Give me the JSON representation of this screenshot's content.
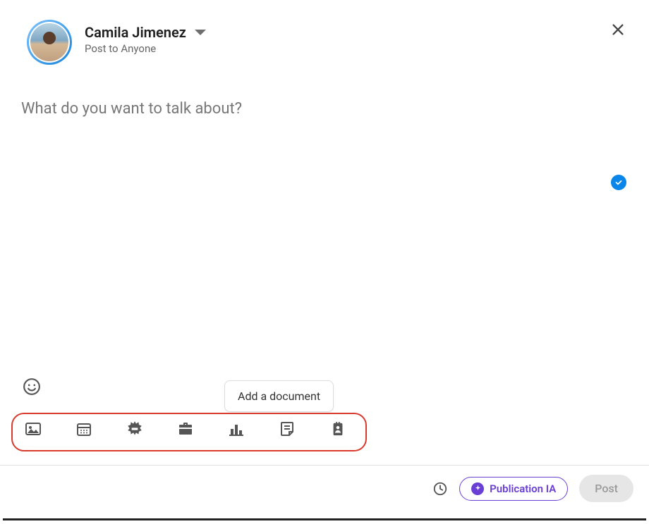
{
  "user": {
    "name": "Camila Jimenez",
    "visibility": "Post to Anyone"
  },
  "composer": {
    "placeholder": "What do you want to talk about?"
  },
  "tooltip": {
    "add_document": "Add a document"
  },
  "toolbar_icons": {
    "photo": "photo-icon",
    "calendar": "calendar-icon",
    "celebrate": "starburst-icon",
    "job": "briefcase-icon",
    "poll": "bar-chart-icon",
    "document": "document-icon",
    "profile": "profile-badge-icon"
  },
  "footer": {
    "ai_label": "Publication IA",
    "post_label": "Post"
  }
}
